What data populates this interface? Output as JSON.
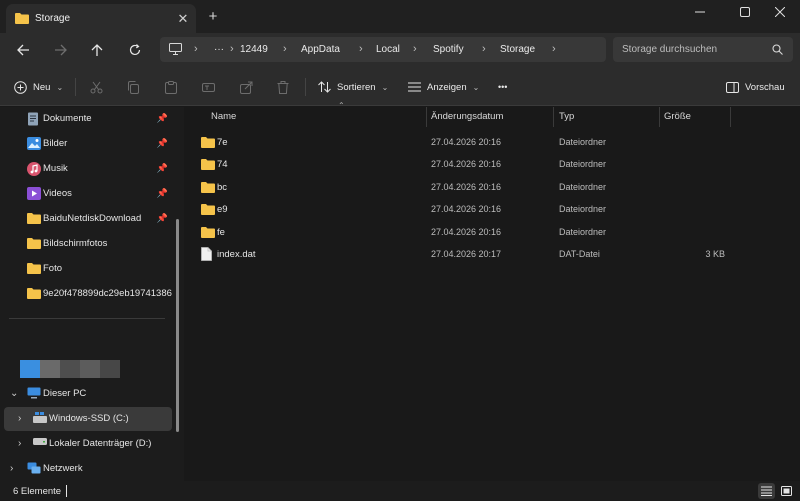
{
  "window": {
    "tab_title": "Storage",
    "tab_close": "✕",
    "new_tab": "+",
    "minimize": "minimize-icon",
    "maximize": "maximize-icon",
    "close": "close-icon"
  },
  "address": {
    "overflow": "···",
    "crumbs": [
      "12449",
      "AppData",
      "Local",
      "Spotify",
      "Storage"
    ],
    "search_placeholder": "Storage durchsuchen"
  },
  "toolbar": {
    "new_label": "Neu",
    "sort_label": "Sortieren",
    "view_label": "Anzeigen",
    "more_label": "•••",
    "preview_label": "Vorschau"
  },
  "sidebar": {
    "quick_access": [
      {
        "label": "Dokumente",
        "pinned": true,
        "icon": "documents-icon"
      },
      {
        "label": "Bilder",
        "pinned": true,
        "icon": "pictures-icon"
      },
      {
        "label": "Musik",
        "pinned": true,
        "icon": "music-icon"
      },
      {
        "label": "Videos",
        "pinned": true,
        "icon": "videos-icon"
      },
      {
        "label": "BaiduNetdiskDownload",
        "pinned": true,
        "icon": "folder-icon"
      },
      {
        "label": "Bildschirmfotos",
        "pinned": false,
        "icon": "folder-icon"
      },
      {
        "label": "Foto",
        "pinned": false,
        "icon": "folder-icon"
      },
      {
        "label": "9e20f478899dc29eb19741386",
        "pinned": false,
        "icon": "folder-icon"
      }
    ],
    "this_pc": "Dieser PC",
    "drives": [
      {
        "label": "Windows-SSD (C:)",
        "selected": true
      },
      {
        "label": "Lokaler Datenträger (D:)",
        "selected": false
      }
    ],
    "network": "Netzwerk"
  },
  "columns": {
    "name": "Name",
    "date": "Änderungsdatum",
    "type": "Typ",
    "size": "Größe"
  },
  "files": [
    {
      "name": "7e",
      "date": "27.04.2026 20:16",
      "type": "Dateiordner",
      "size": "",
      "kind": "folder"
    },
    {
      "name": "74",
      "date": "27.04.2026 20:16",
      "type": "Dateiordner",
      "size": "",
      "kind": "folder"
    },
    {
      "name": "bc",
      "date": "27.04.2026 20:16",
      "type": "Dateiordner",
      "size": "",
      "kind": "folder"
    },
    {
      "name": "e9",
      "date": "27.04.2026 20:16",
      "type": "Dateiordner",
      "size": "",
      "kind": "folder"
    },
    {
      "name": "fe",
      "date": "27.04.2026 20:16",
      "type": "Dateiordner",
      "size": "",
      "kind": "folder"
    },
    {
      "name": "index.dat",
      "date": "27.04.2026 20:17",
      "type": "DAT-Datei",
      "size": "3 KB",
      "kind": "file"
    }
  ],
  "status": {
    "count": "6 Elemente"
  },
  "colors": {
    "folder": "#f5c34a",
    "accent": "#4aa3f0"
  }
}
